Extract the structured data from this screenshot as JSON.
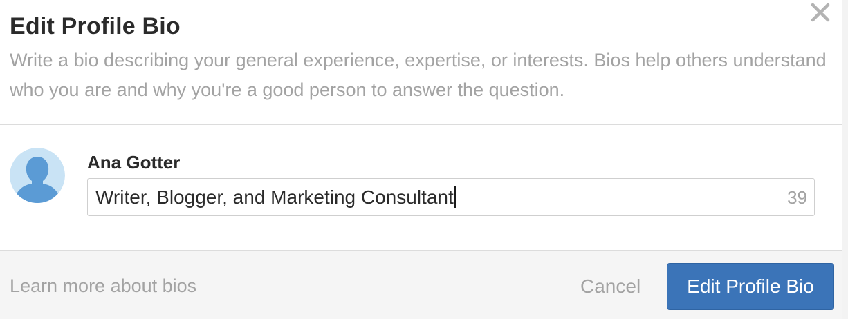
{
  "dialog": {
    "title": "Edit Profile Bio",
    "description": "Write a bio describing your general experience, expertise, or interests. Bios help others understand who you are and why you're a good person to answer the question.",
    "close_icon": "close-icon"
  },
  "user": {
    "name": "Ana Gotter",
    "avatar_icon": "default-user-avatar"
  },
  "bio": {
    "value": "Writer, Blogger, and Marketing Consultant",
    "char_count": "39"
  },
  "footer": {
    "learn_more_label": "Learn more about bios",
    "cancel_label": "Cancel",
    "submit_label": "Edit Profile Bio"
  },
  "colors": {
    "primary_button": "#3b74b8",
    "muted_text": "#a3a3a3",
    "avatar_bg": "#c9e3f5",
    "avatar_figure": "#5b9bd5"
  }
}
